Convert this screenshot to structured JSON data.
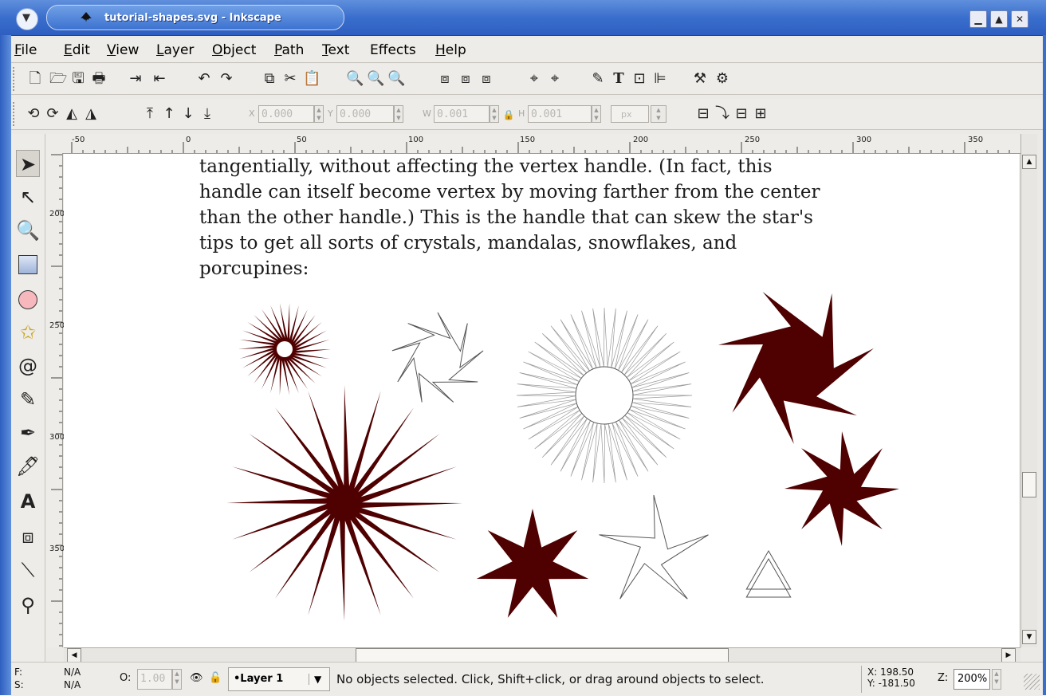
{
  "window": {
    "title": "tutorial-shapes.svg - Inkscape",
    "menu_glyph": "▼",
    "controls": [
      "▁",
      "▲",
      "✕"
    ]
  },
  "menubar": {
    "items": [
      {
        "label": "File",
        "key": "F",
        "rest": "ile"
      },
      {
        "label": "Edit",
        "key": "E",
        "rest": "dit"
      },
      {
        "label": "View",
        "key": "V",
        "rest": "iew"
      },
      {
        "label": "Layer",
        "key": "L",
        "rest": "ayer"
      },
      {
        "label": "Object",
        "key": "O",
        "rest": "bject"
      },
      {
        "label": "Path",
        "key": "P",
        "rest": "ath"
      },
      {
        "label": "Text",
        "key": "T",
        "rest": "ext"
      },
      {
        "label": "Effects",
        "key": "",
        "rest": "Effects"
      },
      {
        "label": "Help",
        "key": "H",
        "rest": "elp"
      }
    ]
  },
  "commands_bar": {
    "icons": [
      "new-document-icon",
      "open-icon",
      "save-icon",
      "print-icon",
      "import-icon",
      "export-icon",
      "undo-icon",
      "redo-icon",
      "duplicate-icon",
      "cut-icon",
      "paste-icon",
      "zoom-selection-icon",
      "zoom-drawing-icon",
      "zoom-page-icon",
      "group-icon",
      "ungroup-icon",
      "clone-icon",
      "fill-stroke-icon",
      "text-properties-icon",
      "xml-editor-icon",
      "align-icon",
      "preferences-icon",
      "document-properties-icon"
    ]
  },
  "select_toolbar": {
    "x_label": "X",
    "x_value": "0.000",
    "y_label": "Y",
    "y_value": "0.000",
    "w_label": "W",
    "w_value": "0.001",
    "h_label": "H",
    "h_value": "0.001",
    "unit": "px"
  },
  "rulers": {
    "h_labels": [
      "-50",
      "0",
      "50",
      "100",
      "150",
      "200",
      "250",
      "300",
      "350"
    ],
    "v_labels": [
      "200",
      "250",
      "300",
      "350"
    ]
  },
  "document": {
    "lines": [
      "tangentially, without affecting the vertex handle. (In fact, this",
      "handle can itself become vertex by moving farther from the center",
      "than the other handle.) This is the handle that can skew the star's",
      "tips to get all sorts of crystals, mandalas, snowflakes, and",
      "porcupines:"
    ],
    "shape_fill": "#4f0000",
    "shape_stroke": "#555555"
  },
  "status": {
    "fill_label": "F:",
    "stroke_label": "S:",
    "fill_value": "N/A",
    "stroke_value": "N/A",
    "opacity_label": "O:",
    "opacity_value": "1.00",
    "layer_name": "•Layer 1",
    "message": "No objects selected. Click, Shift+click, or drag around objects to select.",
    "cursor_x": "X: 198.50",
    "cursor_y": "Y: -181.50",
    "zoom_label": "Z:",
    "zoom_value": "200%"
  }
}
